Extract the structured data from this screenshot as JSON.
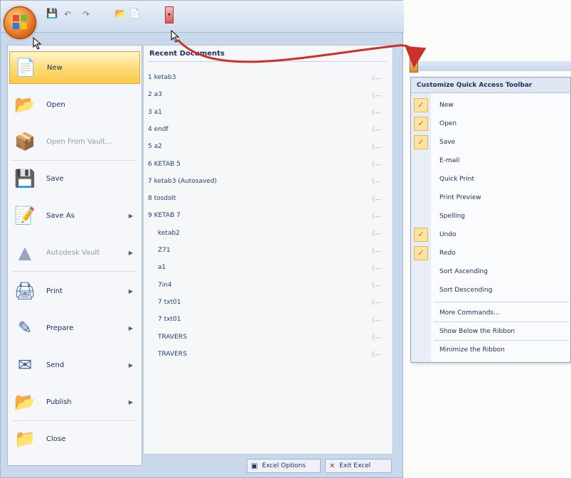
{
  "colors": {
    "accent": "#ffd86d",
    "menu_bg": "#f5f7fa",
    "annotation_arrow": "#c8322a",
    "check_bg": "#fbe3a4"
  },
  "qat": {
    "icons": [
      "save-icon",
      "undo-icon",
      "redo-icon",
      "open-icon",
      "new-icon",
      "customize-arrow-icon"
    ]
  },
  "office_menu": {
    "commands": [
      {
        "label": "New",
        "icon": "new-document-icon",
        "selected": true,
        "arrow": false,
        "dim": false
      },
      {
        "label": "Open",
        "icon": "open-folder-icon",
        "selected": false,
        "arrow": false,
        "dim": false
      },
      {
        "label": "Open From Vault...",
        "icon": "vault-icon",
        "selected": false,
        "arrow": false,
        "dim": true
      },
      {
        "label": "Save",
        "icon": "save-icon",
        "selected": false,
        "arrow": false,
        "dim": false
      },
      {
        "label": "Save As",
        "icon": "save-as-icon",
        "selected": false,
        "arrow": true,
        "dim": false
      },
      {
        "label": "Autodesk Vault",
        "icon": "autodesk-vault-icon",
        "selected": false,
        "arrow": true,
        "dim": true
      },
      {
        "label": "Print",
        "icon": "printer-icon",
        "selected": false,
        "arrow": true,
        "dim": false
      },
      {
        "label": "Prepare",
        "icon": "prepare-icon",
        "selected": false,
        "arrow": true,
        "dim": false
      },
      {
        "label": "Send",
        "icon": "send-icon",
        "selected": false,
        "arrow": true,
        "dim": false
      },
      {
        "label": "Publish",
        "icon": "publish-icon",
        "selected": false,
        "arrow": true,
        "dim": false
      },
      {
        "label": "Close",
        "icon": "close-folder-icon",
        "selected": false,
        "arrow": false,
        "dim": false
      }
    ],
    "recent_title": "Recent Documents",
    "recent_items": [
      "1  ketab3",
      "2  a3",
      "3  a1",
      "4  endf",
      "5  a2",
      "6  KETAB 5",
      "7  ketab3 (Autosaved)",
      "8  tosdolt",
      "9  KETAB 7",
      "ketab2",
      "Z71",
      "a1",
      "7in4",
      "7 txt01",
      "7 txt01",
      "TRAVERS",
      "TRAVERS"
    ],
    "footer": {
      "options_label": "Excel Options",
      "exit_label": "Exit Excel"
    }
  },
  "customize_menu": {
    "title": "Customize Quick Access Toolbar",
    "items": [
      {
        "label": "New",
        "checked": true
      },
      {
        "label": "Open",
        "checked": true
      },
      {
        "label": "Save",
        "checked": true
      },
      {
        "label": "E-mail",
        "checked": false
      },
      {
        "label": "Quick Print",
        "checked": false
      },
      {
        "label": "Print Preview",
        "checked": false
      },
      {
        "label": "Spelling",
        "checked": false
      },
      {
        "label": "Undo",
        "checked": true
      },
      {
        "label": "Redo",
        "checked": true
      },
      {
        "label": "Sort Ascending",
        "checked": false
      },
      {
        "label": "Sort Descending",
        "checked": false
      }
    ],
    "extra_items": [
      "More Commands...",
      "Show Below the Ribbon",
      "Minimize the Ribbon"
    ]
  }
}
